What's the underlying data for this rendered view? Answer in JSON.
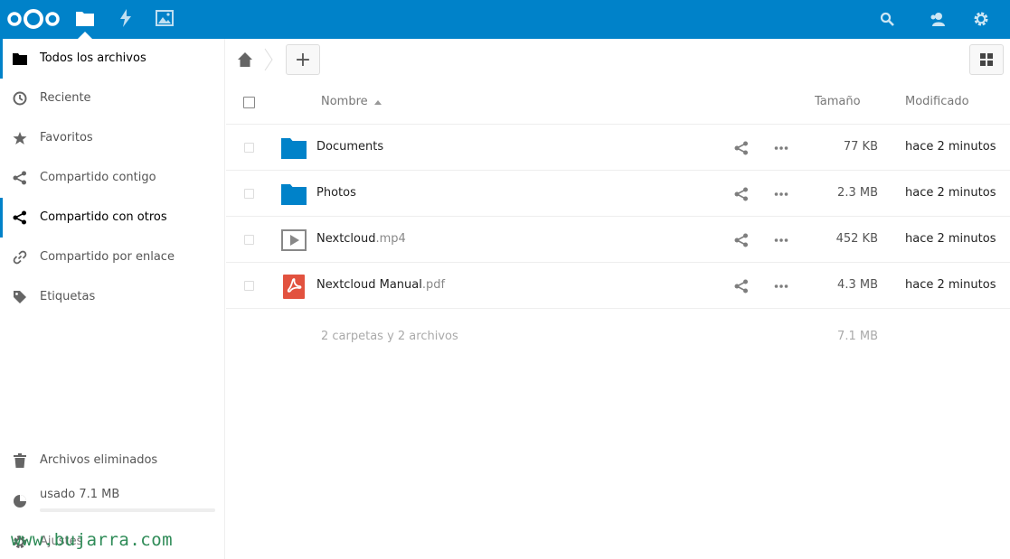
{
  "colors": {
    "brand": "#0082c9",
    "pdf": "#e2523f",
    "folder": "#0082c9"
  },
  "header": {
    "apps": [
      {
        "icon": "folder-icon",
        "active": true
      },
      {
        "icon": "lightning-icon"
      },
      {
        "icon": "image-icon"
      }
    ],
    "right_icons": [
      "search-icon",
      "contacts-icon",
      "gear-icon"
    ]
  },
  "sidebar": {
    "items": [
      {
        "label": "Todos los archivos",
        "icon": "folder-icon",
        "active": true
      },
      {
        "label": "Reciente",
        "icon": "clock-icon"
      },
      {
        "label": "Favoritos",
        "icon": "star-icon"
      },
      {
        "label": "Compartido contigo",
        "icon": "share-icon"
      },
      {
        "label": "Compartido con otros",
        "icon": "share-icon",
        "active": true
      },
      {
        "label": "Compartido por enlace",
        "icon": "link-icon"
      },
      {
        "label": "Etiquetas",
        "icon": "tag-icon"
      }
    ],
    "deleted_label": "Archivos eliminados",
    "quota_label": "usado 7.1 MB",
    "quota_fraction": 0.0,
    "settings_label": "Ajustes"
  },
  "watermark": "www.bujarra.com",
  "toolbar": {
    "new_label": "+"
  },
  "table": {
    "headers": {
      "name": "Nombre",
      "size": "Tamaño",
      "modified": "Modificado"
    },
    "rows": [
      {
        "name": "Documents",
        "ext": "",
        "type": "folder",
        "size": "77 KB",
        "modified": "hace 2 minutos"
      },
      {
        "name": "Photos",
        "ext": "",
        "type": "folder",
        "size": "2.3 MB",
        "modified": "hace 2 minutos"
      },
      {
        "name": "Nextcloud",
        "ext": ".mp4",
        "type": "video",
        "size": "452 KB",
        "modified": "hace 2 minutos"
      },
      {
        "name": "Nextcloud Manual",
        "ext": ".pdf",
        "type": "pdf",
        "size": "4.3 MB",
        "modified": "hace 2 minutos"
      }
    ],
    "summary": {
      "count": "2 carpetas y 2 archivos",
      "total": "7.1 MB"
    }
  }
}
